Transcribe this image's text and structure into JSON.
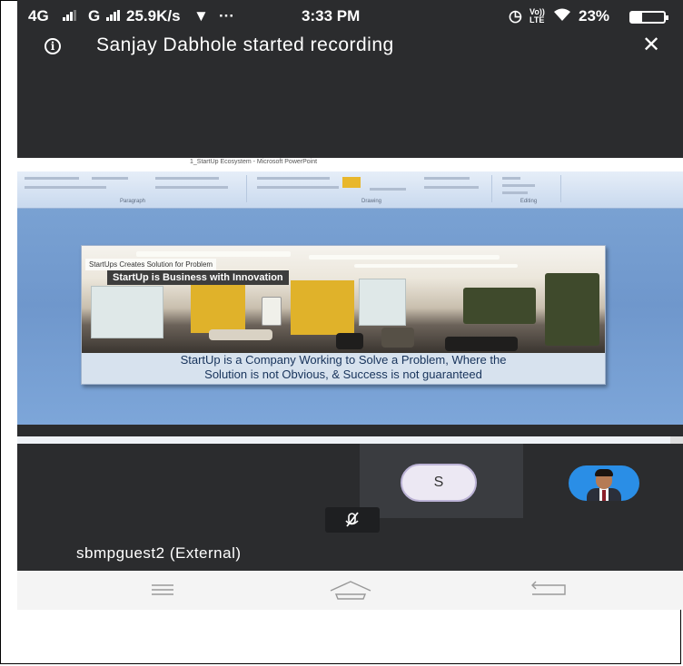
{
  "status_bar": {
    "network_left": "4G",
    "network_mid": "G",
    "speed": "25.9K/s",
    "ellipsis": "···",
    "time": "3:33 PM",
    "volte": "Vo))\nLTE",
    "battery": "23%",
    "battery_level": 0.23
  },
  "banner": {
    "info_icon": "info-icon",
    "message": "Sanjay Dabhole started recording",
    "close_icon": "close-icon"
  },
  "shared_screen": {
    "window_title": "1_StartUp Ecosystem - Microsoft PowerPoint",
    "ribbon_groups": [
      "Paragraph",
      "Drawing",
      "Editing"
    ],
    "slide": {
      "tag_small": "StartUps Creates Solution for Problem",
      "tag_bold": "StartUp is Business with Innovation",
      "caption_line1": "StartUp is a Company Working to Solve a Problem, Where the",
      "caption_line2": "Solution is not Obvious, & Success is not guaranteed"
    }
  },
  "participants": {
    "initial_avatar_letter": "S",
    "mic_icon": "mic-muted-icon",
    "name": "sbmpguest2 (External)"
  },
  "navbar": {
    "icons": [
      "menu-icon",
      "home-icon",
      "back-icon"
    ]
  },
  "colors": {
    "background_dark": "#2b2c2e",
    "slide_blue": "#7fa7d6",
    "avatar_bg": "#ece8f3",
    "profile_bg": "#2a8ee6"
  }
}
